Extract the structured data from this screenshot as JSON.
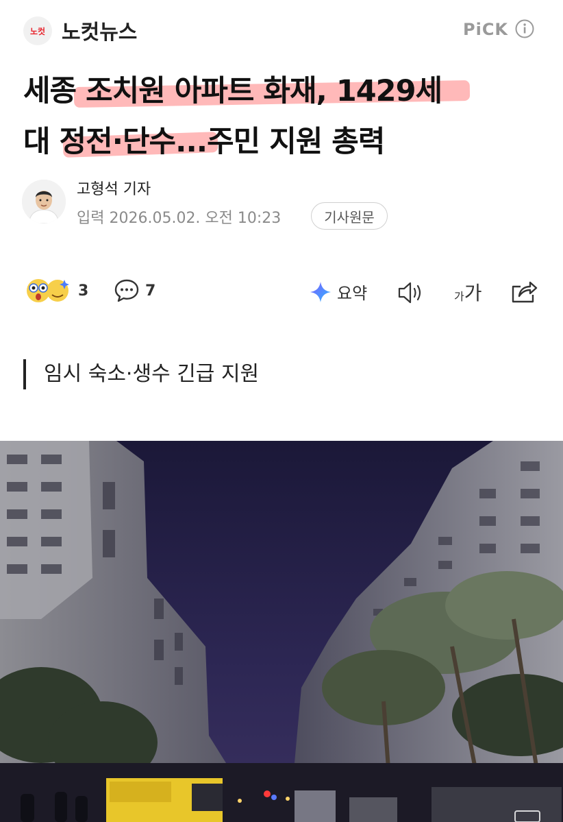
{
  "header": {
    "logo_text": "노컷",
    "press_name": "노컷뉴스",
    "pick_label": "PiCK",
    "info_icon": "info-icon"
  },
  "article": {
    "title_line1": "세종 조치원 아파트 화재, 1429세",
    "title_line2": "대 정전·단수...주민 지원 총력",
    "reporter": "고형석 기자",
    "date": "입력 2026.05.02. 오전 10:23",
    "original_button": "기사원문",
    "subheading": "임시 숙소·생수 긴급 지원"
  },
  "toolbar": {
    "reaction_count": "3",
    "comment_count": "7",
    "summary_label": "요약",
    "font_small": "가",
    "font_large": "가"
  },
  "colors": {
    "highlight": "#ff8a8a",
    "logo_red": "#e8262f",
    "night_sky": "#262147"
  }
}
